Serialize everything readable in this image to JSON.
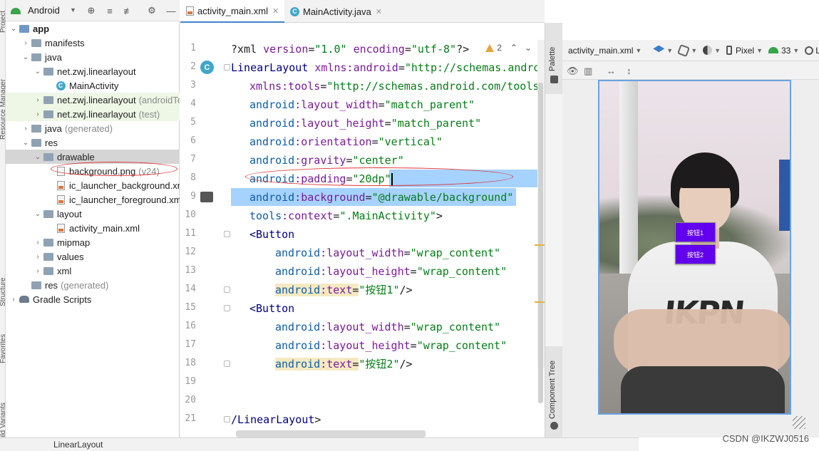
{
  "left_strip": {
    "tabs": [
      "Project",
      "Resource Manager",
      "Structure",
      "Favorites",
      "Build Variants"
    ]
  },
  "project_toolbar": {
    "view_label": "Android"
  },
  "tree": [
    {
      "label": "app",
      "depth": 0,
      "arrow": "down",
      "icon": "module-folder",
      "bold": true
    },
    {
      "label": "manifests",
      "depth": 1,
      "arrow": "right",
      "icon": "folder"
    },
    {
      "label": "java",
      "depth": 1,
      "arrow": "down",
      "icon": "folder"
    },
    {
      "label": "net.zwj.linearlayout",
      "depth": 2,
      "arrow": "down",
      "icon": "package"
    },
    {
      "label": "MainActivity",
      "depth": 3,
      "arrow": "",
      "icon": "class"
    },
    {
      "label": "net.zwj.linearlayout",
      "suffix": "(androidTest)",
      "depth": 2,
      "arrow": "right",
      "icon": "package",
      "style": "green"
    },
    {
      "label": "net.zwj.linearlayout",
      "suffix": "(test)",
      "depth": 2,
      "arrow": "right",
      "icon": "package",
      "style": "green"
    },
    {
      "label": "java",
      "suffix": "(generated)",
      "depth": 1,
      "arrow": "right",
      "icon": "folder"
    },
    {
      "label": "res",
      "depth": 1,
      "arrow": "down",
      "icon": "folder"
    },
    {
      "label": "drawable",
      "depth": 2,
      "arrow": "down",
      "icon": "folder",
      "style": "sel"
    },
    {
      "label": "background.png",
      "suffix": "(v24)",
      "depth": 3,
      "arrow": "",
      "icon": "png"
    },
    {
      "label": "ic_launcher_background.xml",
      "depth": 3,
      "arrow": "",
      "icon": "xml"
    },
    {
      "label": "ic_launcher_foreground.xml",
      "depth": 3,
      "arrow": "",
      "icon": "xml"
    },
    {
      "label": "layout",
      "depth": 2,
      "arrow": "down",
      "icon": "folder"
    },
    {
      "label": "activity_main.xml",
      "depth": 3,
      "arrow": "",
      "icon": "xml"
    },
    {
      "label": "mipmap",
      "depth": 2,
      "arrow": "right",
      "icon": "folder"
    },
    {
      "label": "values",
      "depth": 2,
      "arrow": "right",
      "icon": "folder"
    },
    {
      "label": "xml",
      "depth": 2,
      "arrow": "right",
      "icon": "folder"
    },
    {
      "label": "res",
      "suffix": "(generated)",
      "depth": 1,
      "arrow": "",
      "icon": "folder"
    },
    {
      "label": "Gradle Scripts",
      "depth": 0,
      "arrow": "right",
      "icon": "gradle"
    }
  ],
  "tabs": [
    {
      "label": "activity_main.xml",
      "icon": "xml",
      "active": true
    },
    {
      "label": "MainActivity.java",
      "icon": "class",
      "active": false
    }
  ],
  "editor": {
    "warning_count": "2",
    "line_numbers": [
      "1",
      "2",
      "3",
      "4",
      "5",
      "6",
      "7",
      "8",
      "9",
      "10",
      "11",
      "12",
      "13",
      "14",
      "15",
      "16",
      "17",
      "18",
      "19",
      "20",
      "21"
    ]
  },
  "code_lines": [
    {
      "indent": 0,
      "parts": [
        [
          "p",
          "?xml "
        ],
        [
          "attr",
          "version"
        ],
        [
          "p",
          "="
        ],
        [
          "val",
          "\"1.0\""
        ],
        [
          "p",
          " "
        ],
        [
          "attr",
          "encoding"
        ],
        [
          "p",
          "="
        ],
        [
          "val",
          "\"utf-8\""
        ],
        [
          "p",
          "?>"
        ]
      ]
    },
    {
      "indent": 0,
      "parts": [
        [
          "tag",
          "LinearLayout "
        ],
        [
          "attr",
          "xmlns:android"
        ],
        [
          "p",
          "="
        ],
        [
          "val",
          "\"http://schemas.android.com/apk/res/android\""
        ]
      ]
    },
    {
      "indent": 1,
      "parts": [
        [
          "attr",
          "xmlns:tools"
        ],
        [
          "p",
          "="
        ],
        [
          "val",
          "\"http://schemas.android.com/tools\""
        ]
      ]
    },
    {
      "indent": 1,
      "parts": [
        [
          "ns",
          "android"
        ],
        [
          "attr",
          ":layout_width"
        ],
        [
          "p",
          "="
        ],
        [
          "val",
          "\"match_parent\""
        ]
      ]
    },
    {
      "indent": 1,
      "parts": [
        [
          "ns",
          "android"
        ],
        [
          "attr",
          ":layout_height"
        ],
        [
          "p",
          "="
        ],
        [
          "val",
          "\"match_parent\""
        ]
      ]
    },
    {
      "indent": 1,
      "parts": [
        [
          "ns",
          "android"
        ],
        [
          "attr",
          ":orientation"
        ],
        [
          "p",
          "="
        ],
        [
          "val",
          "\"vertical\""
        ]
      ]
    },
    {
      "indent": 1,
      "parts": [
        [
          "ns",
          "android"
        ],
        [
          "attr",
          ":gravity"
        ],
        [
          "p",
          "="
        ],
        [
          "val",
          "\"center\""
        ]
      ]
    },
    {
      "indent": 1,
      "parts": [
        [
          "ns",
          "android"
        ],
        [
          "attr",
          ":padding"
        ],
        [
          "p",
          "="
        ],
        [
          "val",
          "\"20dp\""
        ]
      ],
      "caret": true
    },
    {
      "indent": 1,
      "parts": [
        [
          "ns",
          "android"
        ],
        [
          "attr",
          ":background"
        ],
        [
          "p",
          "="
        ],
        [
          "val",
          "\"@drawable/background\""
        ]
      ],
      "highlight": true
    },
    {
      "indent": 1,
      "parts": [
        [
          "ns",
          "tools"
        ],
        [
          "attr",
          ":context"
        ],
        [
          "p",
          "="
        ],
        [
          "val",
          "\".MainActivity\""
        ],
        [
          "p",
          ">"
        ]
      ]
    },
    {
      "indent": 1,
      "parts": [
        [
          "tag",
          "<Button"
        ]
      ]
    },
    {
      "indent": 2,
      "parts": [
        [
          "ns",
          "android"
        ],
        [
          "attr",
          ":layout_width"
        ],
        [
          "p",
          "="
        ],
        [
          "val",
          "\"wrap_content\""
        ]
      ]
    },
    {
      "indent": 2,
      "parts": [
        [
          "ns",
          "android"
        ],
        [
          "attr",
          ":layout_height"
        ],
        [
          "p",
          "="
        ],
        [
          "val",
          "\"wrap_content\""
        ]
      ]
    },
    {
      "indent": 2,
      "parts": [
        [
          "ns",
          "android"
        ],
        [
          "attr",
          ":text"
        ],
        [
          "p",
          "="
        ],
        [
          "val",
          "\"按钮1\""
        ],
        [
          "p",
          "/>"
        ]
      ],
      "soft": true
    },
    {
      "indent": 1,
      "parts": [
        [
          "tag",
          "<Button"
        ]
      ]
    },
    {
      "indent": 2,
      "parts": [
        [
          "ns",
          "android"
        ],
        [
          "attr",
          ":layout_width"
        ],
        [
          "p",
          "="
        ],
        [
          "val",
          "\"wrap_content\""
        ]
      ]
    },
    {
      "indent": 2,
      "parts": [
        [
          "ns",
          "android"
        ],
        [
          "attr",
          ":layout_height"
        ],
        [
          "p",
          "="
        ],
        [
          "val",
          "\"wrap_content\""
        ]
      ]
    },
    {
      "indent": 2,
      "parts": [
        [
          "ns",
          "android"
        ],
        [
          "attr",
          ":text"
        ],
        [
          "p",
          "="
        ],
        [
          "val",
          "\"按钮2\""
        ],
        [
          "p",
          "/>"
        ]
      ],
      "soft": true
    },
    {
      "indent": 0,
      "parts": []
    },
    {
      "indent": 0,
      "parts": []
    },
    {
      "indent": 0,
      "parts": [
        [
          "tag",
          "/LinearLayout"
        ],
        [
          "p",
          ">"
        ]
      ]
    }
  ],
  "side_strips": {
    "palette": "Palette",
    "component_tree": "Component Tree"
  },
  "design_toolbar": {
    "file_label": "activity_main.xml",
    "device_label": "Pixel",
    "api_label": "33",
    "locale_label": "Li"
  },
  "preview_buttons": [
    "按钮1",
    "按钮2"
  ],
  "preview_print": "IKPN",
  "breadcrumb": "LinearLayout",
  "watermark": "CSDN @IKZWJ0516",
  "colors": {
    "accent": "#4083c9",
    "button": "#6200ee",
    "selection": "#a6d2ff",
    "annotation": "#e03030"
  }
}
